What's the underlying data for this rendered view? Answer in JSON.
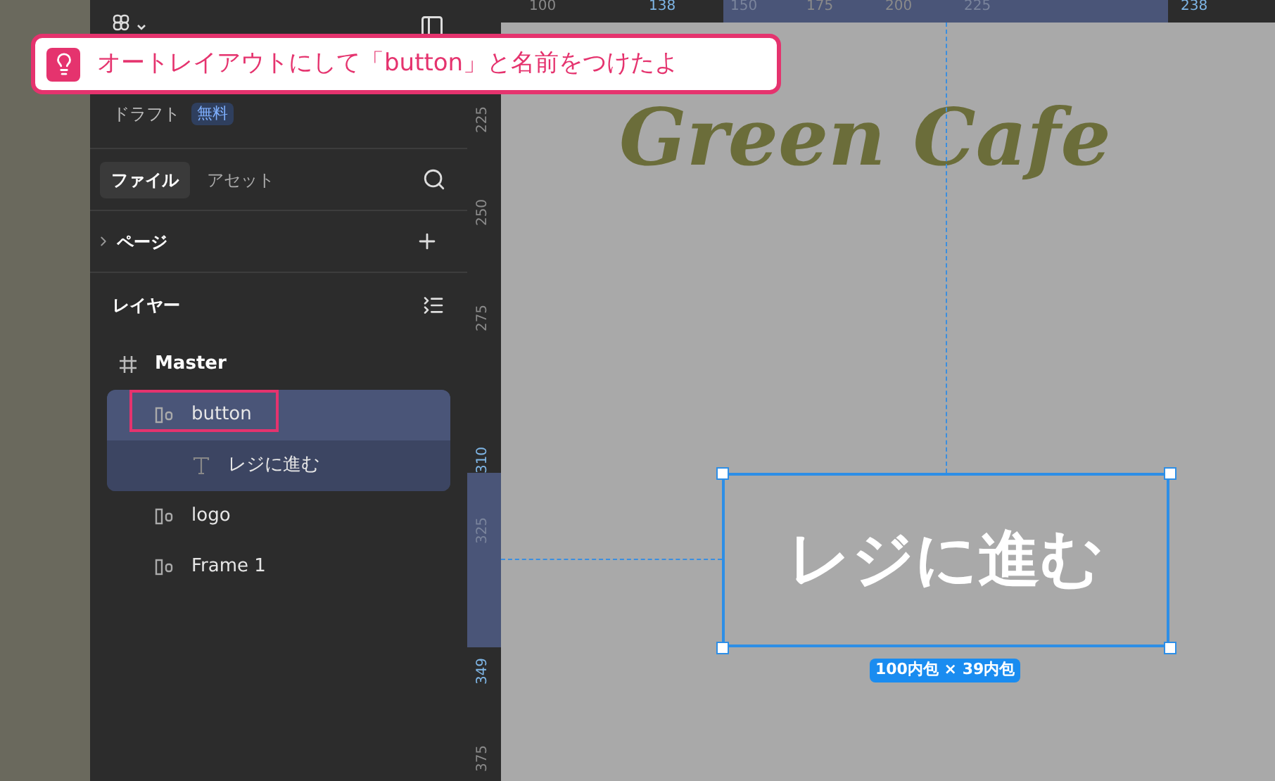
{
  "callout": {
    "text": "オートレイアウトにして「button」と名前をつけたよ"
  },
  "sidebar": {
    "plan": {
      "label": "ドラフト",
      "badge": "無料"
    },
    "tabs": [
      {
        "label": "ファイル",
        "selected": true
      },
      {
        "label": "アセット",
        "selected": false
      }
    ],
    "pages": {
      "label": "ページ",
      "expanded": false
    },
    "layers_title": "レイヤー",
    "layers": [
      {
        "name": "Master",
        "kind": "frame",
        "selected": false,
        "annotated": false,
        "children": [
          {
            "name": "button",
            "kind": "autolayout",
            "selected": true,
            "annotated": true,
            "children": [
              {
                "name": "レジに進む",
                "kind": "text",
                "selected": false,
                "annotated": false
              }
            ]
          },
          {
            "name": "logo",
            "kind": "autolayout",
            "selected": false,
            "annotated": false
          },
          {
            "name": "Frame 1",
            "kind": "autolayout",
            "selected": false,
            "annotated": false
          }
        ]
      }
    ]
  },
  "ruler_top": [
    {
      "label": "100",
      "kind": "normal"
    },
    {
      "label": "138",
      "kind": "marker"
    },
    {
      "label": "150",
      "kind": "dim"
    },
    {
      "label": "175",
      "kind": "normal"
    },
    {
      "label": "200",
      "kind": "normal"
    },
    {
      "label": "225",
      "kind": "dim"
    },
    {
      "label": "238",
      "kind": "marker"
    }
  ],
  "ruler_left": [
    {
      "label": "225",
      "kind": "normal"
    },
    {
      "label": "250",
      "kind": "normal"
    },
    {
      "label": "275",
      "kind": "normal"
    },
    {
      "label": "310",
      "kind": "marker"
    },
    {
      "label": "325",
      "kind": "dim"
    },
    {
      "label": "349",
      "kind": "marker"
    },
    {
      "label": "375",
      "kind": "normal"
    }
  ],
  "canvas": {
    "logo_text": "Green Cafe",
    "button_text": "レジに進む",
    "size_label": "100内包 × 39内包",
    "selected": true
  }
}
